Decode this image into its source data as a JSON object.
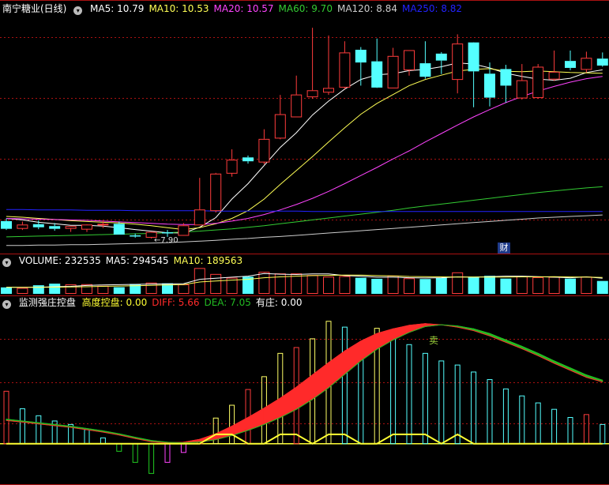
{
  "colors": {
    "up": "#ff3c3c",
    "down": "#54ffff",
    "ma5": "#ffffff",
    "ma10": "#ffff55",
    "ma20": "#ff44ff",
    "ma60": "#33cc33",
    "ma120": "#cccccc",
    "ma250": "#2222ff",
    "frame": "#aa1111",
    "diff": "#ff2a2a",
    "dea": "#22bb22",
    "gaokong": "#ffff33"
  },
  "price_panel": {
    "stock_name": "南宁糖业(日线)",
    "ma": [
      {
        "label": "MA5:",
        "value": "10.79",
        "color": "#ffffff"
      },
      {
        "label": "MA10:",
        "value": "10.53",
        "color": "#ffff55"
      },
      {
        "label": "MA20:",
        "value": "10.57",
        "color": "#ff44ff"
      },
      {
        "label": "MA60:",
        "value": "9.70",
        "color": "#33cc33"
      },
      {
        "label": "MA120:",
        "value": "8.84",
        "color": "#cccccc"
      },
      {
        "label": "MA250:",
        "value": "8.82",
        "color": "#2222ff"
      }
    ],
    "low_label": "7.90",
    "badge": "财"
  },
  "volume_panel": {
    "items": [
      {
        "label": "VOLUME:",
        "value": "232535",
        "color": "#ffffff"
      },
      {
        "label": "MA5:",
        "value": "294545",
        "color": "#ffffff"
      },
      {
        "label": "MA10:",
        "value": "189563",
        "color": "#ffff55"
      }
    ]
  },
  "indicator_panel": {
    "name": "监测强庄控盘",
    "items": [
      {
        "label": "高度控盘:",
        "value": "0.00",
        "color": "#ffff33"
      },
      {
        "label": "DIFF:",
        "value": "5.66",
        "color": "#ff2a2a"
      },
      {
        "label": "DEA:",
        "value": "7.05",
        "color": "#22bb22"
      },
      {
        "label": "有庄:",
        "value": "0.00",
        "color": "#ffffff"
      }
    ],
    "sell_label": "卖"
  },
  "chart_data": {
    "type": "candlestick",
    "x": [
      0,
      1,
      2,
      3,
      4,
      5,
      6,
      7,
      8,
      9,
      10,
      11,
      12,
      13,
      14,
      15,
      16,
      17,
      18,
      19,
      20,
      21,
      22,
      23,
      24,
      25,
      26,
      27,
      28,
      29,
      30,
      31,
      32,
      33,
      34,
      35,
      36,
      37
    ],
    "open": [
      8.33,
      8.15,
      8.25,
      8.2,
      8.15,
      8.13,
      8.25,
      8.26,
      7.96,
      7.92,
      8.04,
      7.97,
      8.24,
      8.61,
      9.58,
      9.98,
      9.87,
      10.49,
      11.04,
      11.56,
      11.68,
      11.81,
      12.77,
      12.47,
      11.79,
      12.26,
      12.42,
      12.67,
      12.01,
      12.96,
      12.15,
      12.27,
      11.53,
      11.54,
      12.02,
      12.48,
      12.27,
      12.54
    ],
    "high": [
      8.4,
      8.32,
      8.35,
      8.28,
      8.2,
      8.23,
      8.34,
      8.32,
      8.01,
      7.96,
      8.1,
      8.28,
      9.45,
      9.58,
      10.19,
      10.03,
      10.71,
      11.6,
      12.1,
      13.34,
      13.14,
      12.99,
      12.84,
      13.06,
      12.82,
      12.73,
      12.99,
      12.71,
      13.17,
      12.72,
      12.44,
      12.38,
      12.4,
      12.4,
      12.75,
      12.75,
      12.72,
      12.7
    ],
    "low": [
      8.1,
      8.1,
      8.12,
      8.08,
      8.05,
      8.05,
      8.15,
      8.18,
      7.9,
      7.88,
      7.92,
      7.95,
      8.22,
      8.55,
      9.48,
      9.82,
      9.8,
      10.45,
      11.02,
      11.5,
      11.6,
      11.75,
      11.84,
      11.78,
      11.82,
      12.1,
      12.02,
      12.14,
      11.64,
      11.28,
      11.3,
      11.4,
      11.48,
      11.5,
      11.96,
      12.24,
      12.18,
      12.33
    ],
    "close": [
      8.13,
      8.24,
      8.17,
      8.13,
      8.2,
      8.24,
      8.26,
      7.98,
      7.93,
      8.05,
      8.01,
      8.22,
      8.63,
      9.56,
      9.92,
      9.88,
      10.46,
      11.1,
      11.61,
      11.72,
      11.78,
      12.7,
      12.44,
      11.79,
      12.61,
      12.76,
      12.07,
      12.49,
      12.93,
      12.21,
      11.53,
      11.84,
      11.98,
      12.33,
      12.2,
      12.3,
      12.56,
      12.36
    ],
    "volume": [
      60,
      55,
      80,
      95,
      88,
      90,
      75,
      62,
      92,
      105,
      98,
      88,
      240,
      185,
      150,
      160,
      205,
      190,
      190,
      175,
      160,
      165,
      150,
      140,
      170,
      145,
      138,
      150,
      200,
      160,
      168,
      142,
      165,
      155,
      158,
      142,
      160,
      120
    ],
    "ma_series": [
      {
        "name": "MA5",
        "values": [
          8.4,
          8.36,
          8.3,
          8.26,
          8.22,
          8.22,
          8.2,
          8.16,
          8.11,
          8.07,
          8.03,
          8.02,
          8.17,
          8.42,
          8.9,
          9.3,
          9.77,
          10.24,
          10.62,
          11.08,
          11.44,
          11.75,
          12.0,
          12.12,
          12.15,
          12.23,
          12.26,
          12.33,
          12.43,
          12.4,
          12.3,
          12.16,
          12.08,
          12.01,
          11.98,
          12.03,
          12.18,
          12.25
        ]
      },
      {
        "name": "MA10",
        "values": [
          8.45,
          8.43,
          8.4,
          8.37,
          8.34,
          8.32,
          8.3,
          8.28,
          8.25,
          8.21,
          8.16,
          8.11,
          8.16,
          8.26,
          8.4,
          8.6,
          8.9,
          9.28,
          9.64,
          10.0,
          10.38,
          10.75,
          11.1,
          11.38,
          11.61,
          11.84,
          12.0,
          12.11,
          12.22,
          12.26,
          12.28,
          12.21,
          12.2,
          12.22,
          12.2,
          12.18,
          12.17,
          12.16
        ]
      },
      {
        "name": "MA20",
        "values": [
          8.4,
          8.39,
          8.38,
          8.37,
          8.36,
          8.35,
          8.33,
          8.31,
          8.29,
          8.27,
          8.25,
          8.24,
          8.24,
          8.27,
          8.33,
          8.4,
          8.5,
          8.62,
          8.76,
          8.92,
          9.1,
          9.3,
          9.51,
          9.72,
          9.94,
          10.15,
          10.38,
          10.6,
          10.82,
          11.03,
          11.22,
          11.4,
          11.56,
          11.7,
          11.82,
          11.93,
          12.02,
          12.08
        ]
      },
      {
        "name": "MA60",
        "values": [
          7.92,
          7.93,
          7.94,
          7.95,
          7.96,
          7.97,
          7.98,
          7.99,
          8.0,
          8.01,
          8.03,
          8.05,
          8.07,
          8.1,
          8.13,
          8.17,
          8.21,
          8.26,
          8.31,
          8.36,
          8.41,
          8.46,
          8.51,
          8.56,
          8.61,
          8.67,
          8.72,
          8.77,
          8.82,
          8.87,
          8.92,
          8.97,
          9.02,
          9.07,
          9.11,
          9.15,
          9.19,
          9.22
        ]
      },
      {
        "name": "MA120",
        "values": [
          7.7,
          7.7,
          7.71,
          7.71,
          7.72,
          7.72,
          7.73,
          7.74,
          7.75,
          7.76,
          7.77,
          7.79,
          7.81,
          7.83,
          7.86,
          7.88,
          7.91,
          7.93,
          7.96,
          7.99,
          8.02,
          8.05,
          8.08,
          8.11,
          8.14,
          8.17,
          8.2,
          8.23,
          8.26,
          8.29,
          8.32,
          8.35,
          8.38,
          8.41,
          8.43,
          8.45,
          8.47,
          8.49
        ]
      },
      {
        "name": "MA250",
        "values": [
          8.63,
          8.63,
          8.62,
          8.62,
          8.62,
          8.61,
          8.61,
          8.61,
          8.6,
          8.6,
          8.6,
          8.6,
          8.6,
          8.59,
          8.59,
          8.59,
          8.59,
          8.59,
          8.59,
          8.58,
          8.58,
          8.58,
          8.58,
          8.58,
          8.58,
          8.58,
          8.58,
          8.58,
          8.58,
          8.58,
          8.58,
          8.58,
          8.58,
          8.58,
          8.58,
          8.58,
          8.58,
          8.58
        ]
      }
    ],
    "volume_ma": [
      {
        "name": "MA5",
        "values": [
          62,
          60,
          62,
          66,
          70,
          78,
          83,
          85,
          88,
          91,
          93,
          95,
          135,
          145,
          155,
          165,
          190,
          183,
          180,
          185,
          185,
          170,
          165,
          155,
          155,
          150,
          148,
          150,
          158,
          155,
          160,
          165,
          165,
          160,
          155,
          150,
          158,
          145
        ]
      },
      {
        "name": "MA10",
        "values": [
          60,
          60,
          61,
          62,
          64,
          66,
          70,
          73,
          76,
          79,
          82,
          86,
          110,
          120,
          128,
          135,
          150,
          158,
          165,
          170,
          172,
          175,
          175,
          170,
          168,
          162,
          160,
          158,
          156,
          156,
          156,
          156,
          158,
          158,
          160,
          157,
          156,
          152
        ]
      }
    ],
    "indicator": {
      "diff": [
        4.0,
        3.7,
        3.4,
        3.1,
        2.8,
        2.4,
        2.0,
        1.5,
        0.9,
        0.35,
        0.15,
        0.25,
        0.75,
        1.7,
        3.0,
        4.5,
        6.1,
        7.8,
        9.7,
        11.8,
        13.9,
        15.9,
        17.6,
        18.9,
        19.7,
        20.3,
        20.6,
        20.4,
        20.0,
        19.4,
        18.5,
        17.4,
        16.3,
        15.1,
        13.8,
        12.6,
        11.4,
        10.6
      ],
      "dea": [
        4.2,
        3.9,
        3.6,
        3.3,
        3.0,
        2.6,
        2.2,
        1.7,
        1.1,
        0.55,
        0.25,
        0.15,
        0.3,
        0.7,
        1.4,
        2.3,
        3.3,
        4.5,
        5.9,
        7.6,
        9.6,
        11.9,
        14.2,
        16.2,
        17.8,
        19.1,
        20.1,
        20.4,
        20.2,
        19.7,
        18.9,
        17.8,
        16.7,
        15.5,
        14.2,
        13.0,
        11.8,
        10.9
      ],
      "bars": [
        9.0,
        6.0,
        4.8,
        3.9,
        3.3,
        2.4,
        1.0,
        -1.3,
        -3.2,
        -5.1,
        -3.2,
        -1.5,
        0.5,
        4.4,
        6.6,
        9.3,
        11.5,
        15.5,
        16.5,
        18.0,
        21.0,
        20.0,
        17.0,
        19.8,
        19.0,
        17.0,
        15.5,
        14.2,
        13.5,
        12.3,
        11.0,
        9.4,
        8.2,
        7.0,
        5.9,
        4.5,
        5.0,
        3.3
      ],
      "gaokong": [
        0,
        0,
        0,
        0,
        0,
        0,
        0,
        0,
        0,
        0,
        0,
        0,
        0,
        1.6,
        1.6,
        0,
        0,
        1.6,
        1.6,
        0,
        1.6,
        1.6,
        0,
        0,
        1.6,
        1.6,
        1.6,
        0,
        1.6,
        0,
        0,
        0,
        0,
        0,
        0,
        0,
        0,
        0
      ]
    },
    "ylim_price": [
      7.55,
      13.65
    ],
    "ylim_volume": [
      0,
      250
    ],
    "ylim_indicator": [
      -6,
      23
    ]
  }
}
